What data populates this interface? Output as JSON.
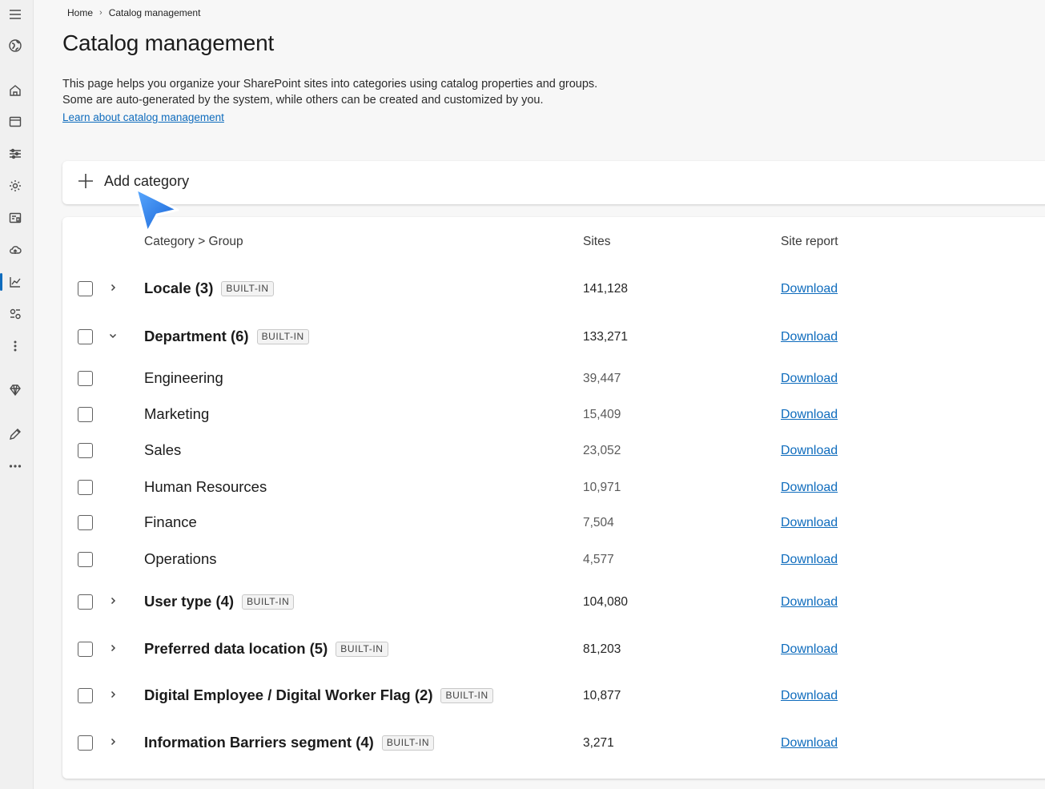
{
  "breadcrumb": {
    "home": "Home",
    "separator": "›",
    "current": "Catalog management"
  },
  "page": {
    "title": "Catalog management",
    "description_line1": "This page helps you organize your SharePoint sites into categories using catalog properties and groups.",
    "description_line2": "Some are auto-generated by the system, while others can be created and customized by you.",
    "learn_link": "Learn about catalog management"
  },
  "toolbar": {
    "add_category_label": "Add category"
  },
  "table": {
    "headers": {
      "name": "Category > Group",
      "sites": "Sites",
      "report": "Site report"
    },
    "rows": [
      {
        "kind": "category",
        "expanded": false,
        "name": "Locale (3)",
        "badge": "BUILT-IN",
        "sites": "141,128",
        "report": "Download"
      },
      {
        "kind": "category",
        "expanded": true,
        "name": "Department (6)",
        "badge": "BUILT-IN",
        "sites": "133,271",
        "report": "Download"
      },
      {
        "kind": "group",
        "name": "Engineering",
        "sites": "39,447",
        "report": "Download"
      },
      {
        "kind": "group",
        "name": "Marketing",
        "sites": "15,409",
        "report": "Download"
      },
      {
        "kind": "group",
        "name": "Sales",
        "sites": "23,052",
        "report": "Download"
      },
      {
        "kind": "group",
        "name": "Human Resources",
        "sites": "10,971",
        "report": "Download"
      },
      {
        "kind": "group",
        "name": "Finance",
        "sites": "7,504",
        "report": "Download"
      },
      {
        "kind": "group",
        "name": "Operations",
        "sites": "4,577",
        "report": "Download"
      },
      {
        "kind": "category",
        "expanded": false,
        "name": "User type (4)",
        "badge": "BUILT-IN",
        "sites": "104,080",
        "report": "Download"
      },
      {
        "kind": "category",
        "expanded": false,
        "name": "Preferred data location (5)",
        "badge": "BUILT-IN",
        "sites": "81,203",
        "report": "Download"
      },
      {
        "kind": "category",
        "expanded": false,
        "name": "Digital Employee / Digital Worker Flag (2)",
        "badge": "BUILT-IN",
        "sites": "10,877",
        "report": "Download"
      },
      {
        "kind": "category",
        "expanded": false,
        "name": "Information Barriers segment (4)",
        "badge": "BUILT-IN",
        "sites": "3,271",
        "report": "Download"
      }
    ]
  },
  "rail_icons": [
    "hamburger-icon",
    "globe-icon",
    "home-icon",
    "window-icon",
    "sliders-icon",
    "settings-icon",
    "reports-icon",
    "cloud-icon",
    "chart-icon",
    "people-settings-icon",
    "more-vertical-icon",
    "diamond-icon",
    "pencil-icon",
    "more-horizontal-icon"
  ],
  "colors": {
    "accent": "#0f6cbd",
    "cursor": "#1f7fe0"
  }
}
